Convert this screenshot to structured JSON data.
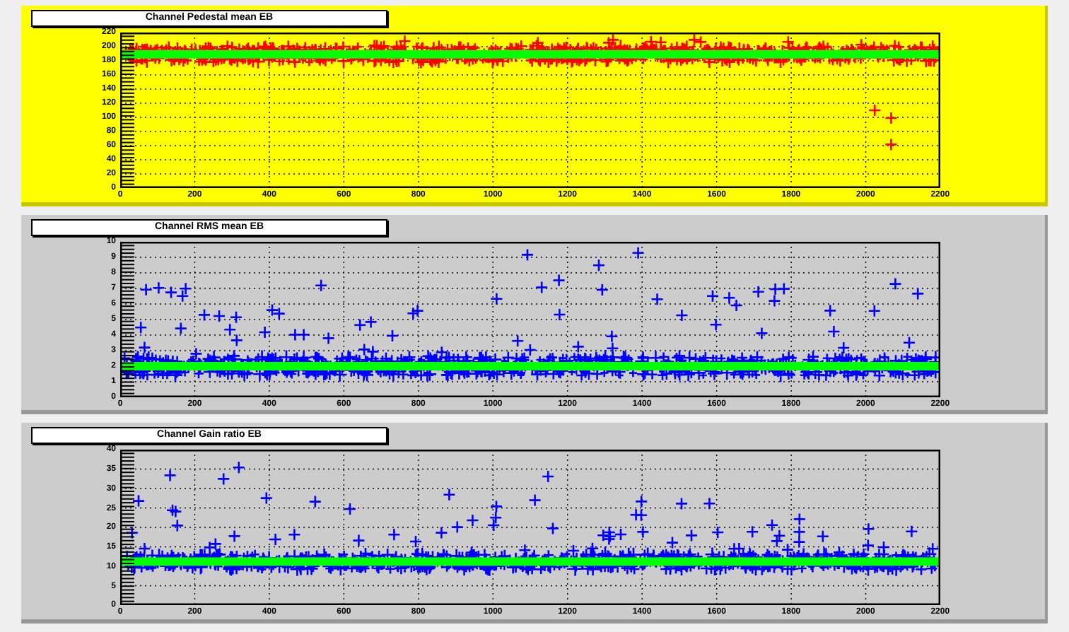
{
  "panels": [
    {
      "title": "Channel Pedestal mean EB",
      "alarm": true,
      "color": "#ff0000",
      "yticks": [
        "220",
        "200",
        "180",
        "160",
        "140",
        "120",
        "100",
        "80",
        "60",
        "40",
        "20",
        "0"
      ],
      "xticks": [
        "0",
        "200",
        "400",
        "600",
        "800",
        "1000",
        "1200",
        "1400",
        "1600",
        "1800",
        "2000",
        "2200"
      ]
    },
    {
      "title": "Channel RMS mean EB",
      "alarm": false,
      "color": "#0000ff",
      "yticks": [
        "10",
        "9",
        "8",
        "7",
        "6",
        "5",
        "4",
        "3",
        "2",
        "1",
        "0"
      ],
      "xticks": [
        "0",
        "200",
        "400",
        "600",
        "800",
        "1000",
        "1200",
        "1400",
        "1600",
        "1800",
        "2000",
        "2200"
      ]
    },
    {
      "title": "Channel Gain ratio EB",
      "alarm": false,
      "color": "#0000ff",
      "yticks": [
        "40",
        "35",
        "30",
        "25",
        "20",
        "15",
        "10",
        "5",
        "0"
      ],
      "xticks": [
        "0",
        "200",
        "400",
        "600",
        "800",
        "1000",
        "1200",
        "1400",
        "1600",
        "1800",
        "2000",
        "2200"
      ]
    }
  ]
}
